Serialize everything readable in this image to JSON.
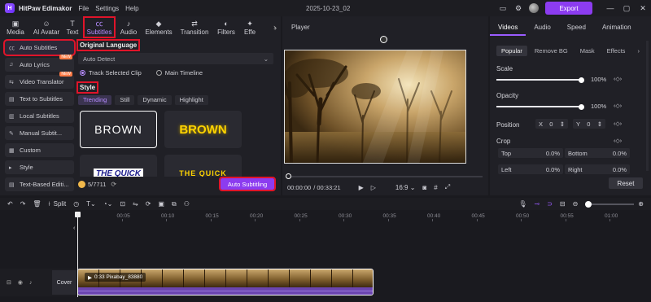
{
  "titlebar": {
    "app_name": "HitPaw Edimakor",
    "menus": [
      "File",
      "Settings",
      "Help"
    ],
    "project_title": "2025-10-23_02",
    "export_label": "Export"
  },
  "tools": [
    {
      "label": "Media",
      "icon": "media-icon"
    },
    {
      "label": "AI Avatar",
      "icon": "ai-avatar-icon"
    },
    {
      "label": "Text",
      "icon": "text-icon"
    },
    {
      "label": "Subtitles",
      "icon": "subtitles-icon"
    },
    {
      "label": "Audio",
      "icon": "audio-icon"
    },
    {
      "label": "Elements",
      "icon": "elements-icon"
    },
    {
      "label": "Transition",
      "icon": "transition-icon"
    },
    {
      "label": "Filters",
      "icon": "filters-icon"
    },
    {
      "label": "Effe",
      "icon": "effects-icon"
    }
  ],
  "side_items": [
    {
      "label": "Auto Subtitles",
      "badge": ""
    },
    {
      "label": "Auto Lyrics",
      "badge": "NEW"
    },
    {
      "label": "Video Translator",
      "badge": "NEW"
    },
    {
      "label": "Text to Subtitles",
      "badge": ""
    },
    {
      "label": "Local Subtitles",
      "badge": ""
    },
    {
      "label": "Manual Subtit...",
      "badge": ""
    },
    {
      "label": "Custom",
      "badge": ""
    },
    {
      "label": "Style",
      "badge": ""
    },
    {
      "label": "Text-Based Editi...",
      "badge": ""
    }
  ],
  "subtitles": {
    "original_language_title": "Original Language",
    "language_value": "Auto Detect",
    "radio_track": "Track Selected Clip",
    "radio_main": "Main Timeline",
    "style_title": "Style",
    "style_tabs": [
      "Trending",
      "Still",
      "Dynamic",
      "Highlight"
    ],
    "cards": [
      "BROWN",
      "BROWN",
      "THE QUICK",
      "THE QUICK"
    ],
    "credits": "5/7711",
    "auto_button": "Auto Subtitling"
  },
  "player": {
    "title": "Player",
    "time_current": "00:00:00",
    "time_total": "/ 00:33:21",
    "ratio": "16:9"
  },
  "properties": {
    "tabs": [
      "Videos",
      "Audio",
      "Speed",
      "Animation"
    ],
    "subtabs": [
      "Popular",
      "Remove BG",
      "Mask",
      "Effects"
    ],
    "scale_label": "Scale",
    "scale_value": "100%",
    "scale_level": 1.0,
    "opacity_label": "Opacity",
    "opacity_value": "100%",
    "opacity_level": 1.0,
    "position_label": "Position",
    "pos_x_label": "X",
    "pos_x_value": "0",
    "pos_y_label": "Y",
    "pos_y_value": "0",
    "crop_label": "Crop",
    "crop_top_label": "Top",
    "crop_top_value": "0.0%",
    "crop_bottom_label": "Bottom",
    "crop_bottom_value": "0.0%",
    "crop_left_label": "Left",
    "crop_left_value": "0.0%",
    "crop_right_label": "Right",
    "crop_right_value": "0.0%",
    "reset_label": "Reset"
  },
  "timeline": {
    "split_label": "Split",
    "ticks": [
      "00:05",
      "00:10",
      "00:15",
      "00:20",
      "00:25",
      "00:30",
      "00:35",
      "00:40",
      "00:45",
      "00:50",
      "00:55",
      "01:00"
    ],
    "cover_label": "Cover",
    "clip_label": "0:33  Pixabay_83880"
  },
  "colors": {
    "accent": "#8c3cf0",
    "highlight": "#e0142a"
  }
}
